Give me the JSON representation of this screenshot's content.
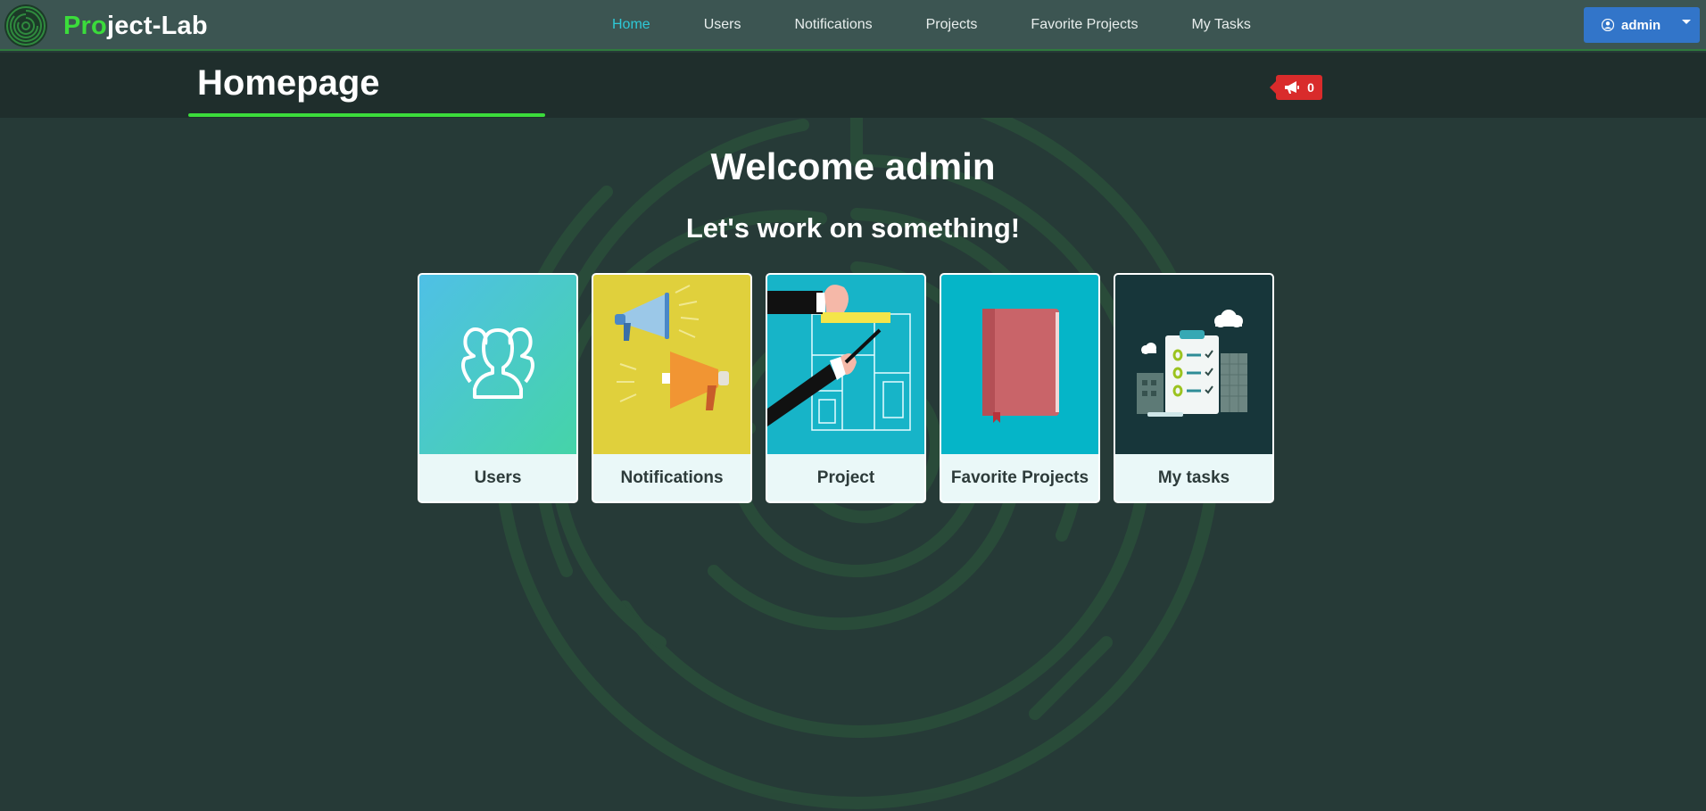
{
  "app": {
    "brand_accent": "Pro",
    "brand_rest": "ject-Lab",
    "accent_color": "#3bdc3b"
  },
  "nav": {
    "items": [
      {
        "label": "Home",
        "active": true
      },
      {
        "label": "Users",
        "active": false
      },
      {
        "label": "Notifications",
        "active": false
      },
      {
        "label": "Projects",
        "active": false
      },
      {
        "label": "Favorite Projects",
        "active": false
      },
      {
        "label": "My Tasks",
        "active": false
      }
    ],
    "user": {
      "name": "admin",
      "icon": "user-circle-icon"
    }
  },
  "header": {
    "title": "Homepage",
    "announcements": {
      "count": "0",
      "icon": "bullhorn-icon",
      "color": "#d92b2b"
    }
  },
  "main": {
    "welcome": "Welcome admin",
    "tagline": "Let's work on something!",
    "cards": [
      {
        "label": "Users",
        "icon": "users-illustration"
      },
      {
        "label": "Notifications",
        "icon": "megaphones-illustration"
      },
      {
        "label": "Project",
        "icon": "blueprint-drawing-illustration"
      },
      {
        "label": "Favorite Projects",
        "icon": "bookmarked-book-illustration"
      },
      {
        "label": "My tasks",
        "icon": "task-clipboard-illustration"
      }
    ]
  }
}
